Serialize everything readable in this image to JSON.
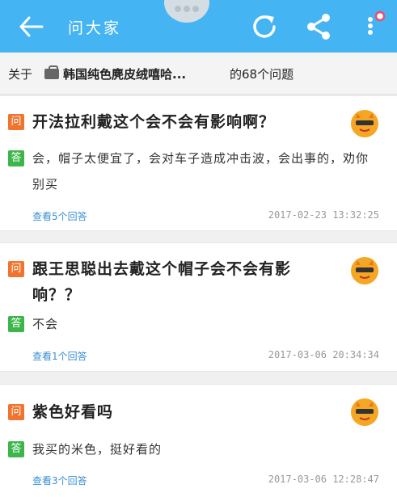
{
  "header": {
    "title": "问大家"
  },
  "about_bar": {
    "prefix": "关于",
    "product": "韩国纯色麂皮绒嘻哈...",
    "count_text": "的68个问题"
  },
  "questions": [
    {
      "q_badge": "问",
      "question": "开法拉利戴这个会不会有影响啊？",
      "a_badge": "答",
      "answer": "会，帽子太便宜了，会对车子造成冲击波，会出事的，劝你别买",
      "view_answers": "查看5个回答",
      "time": "2017-02-23 13:32:25"
    },
    {
      "q_badge": "问",
      "question": "跟王思聪出去戴这个帽子会不会有影响？？",
      "a_badge": "答",
      "answer": "不会",
      "view_answers": "查看1个回答",
      "time": "2017-03-06 20:34:34"
    },
    {
      "q_badge": "问",
      "question": "紫色好看吗",
      "a_badge": "答",
      "answer": "我买的米色，挺好看的",
      "view_answers": "查看3个回答",
      "time": "2017-03-06 12:28:47"
    }
  ],
  "colors": {
    "header_bg": "#45b4f2",
    "question_badge": "#f0742e",
    "answer_badge": "#3cb64a",
    "link": "#3a8fd1"
  },
  "icons": {
    "back": "back-arrow-icon",
    "refresh": "refresh-icon",
    "share": "share-icon",
    "more": "more-vertical-icon",
    "avatar": "avatar-icon"
  }
}
